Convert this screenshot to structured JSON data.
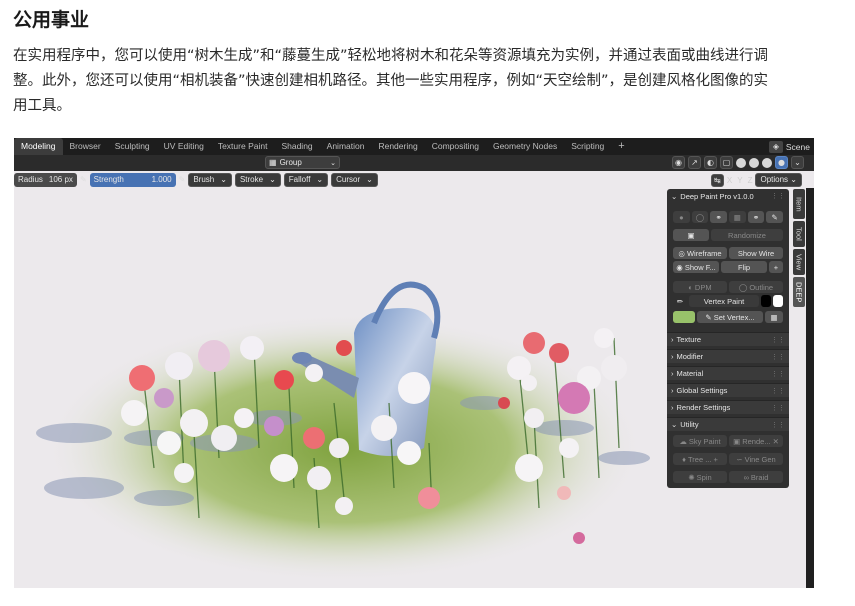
{
  "article": {
    "heading": "公用事业",
    "lines": [
      "在实用程序中，您可以使用“树木生成”和“藤蔓生成”轻松地将树木和花朵等资源填充为实例，并通过表面或曲线进行调",
      "整。此外，您还可以使用“相机装备”快速创建相机路径。其他一些实用程序，例如“天空绘制”，是创建风格化图像的实",
      "用工具。"
    ]
  },
  "blender": {
    "workspace_tabs": [
      "Modeling",
      "Browser",
      "Sculpting",
      "UV Editing",
      "Texture Paint",
      "Shading",
      "Animation",
      "Rendering",
      "Compositing",
      "Geometry Nodes",
      "Scripting",
      "+"
    ],
    "active_tab": "Modeling",
    "scene_label": "Scene",
    "group_selector": "Group",
    "tool_header": {
      "radius_label": "Radius",
      "radius_value": "106 px",
      "strength_label": "Strength",
      "strength_value": "1.000",
      "brush": "Brush",
      "stroke": "Stroke",
      "falloff": "Falloff",
      "cursor": "Cursor"
    },
    "axes": [
      "X",
      "Y",
      "Z"
    ],
    "options": "Options",
    "npanel": {
      "title": "Deep Paint Pro v1.0.0",
      "randomize": "Randomize",
      "wireframe": "Wireframe",
      "show_wire": "Show Wire",
      "show_f": "Show F...",
      "flip": "Flip",
      "plus": "+",
      "dpm": "DPM",
      "outline": "Outline",
      "vertex_paint": "Vertex Paint",
      "set_vertex": "Set Vertex...",
      "sections": [
        "Texture",
        "Modifier",
        "Material",
        "Global Settings",
        "Render Settings"
      ],
      "utility": "Utility",
      "sky_paint": "Sky Paint",
      "render": "Rende...",
      "tree": "Tree ...",
      "vine_gen": "Vine Gen",
      "spin": "Spin",
      "braid": "Braid"
    },
    "side_tabs": [
      "Item",
      "Tool",
      "View",
      "DEEP"
    ],
    "colors": {
      "accent": "#4772b3",
      "vertex_green": "#98c26a",
      "panel": "#303030"
    }
  }
}
